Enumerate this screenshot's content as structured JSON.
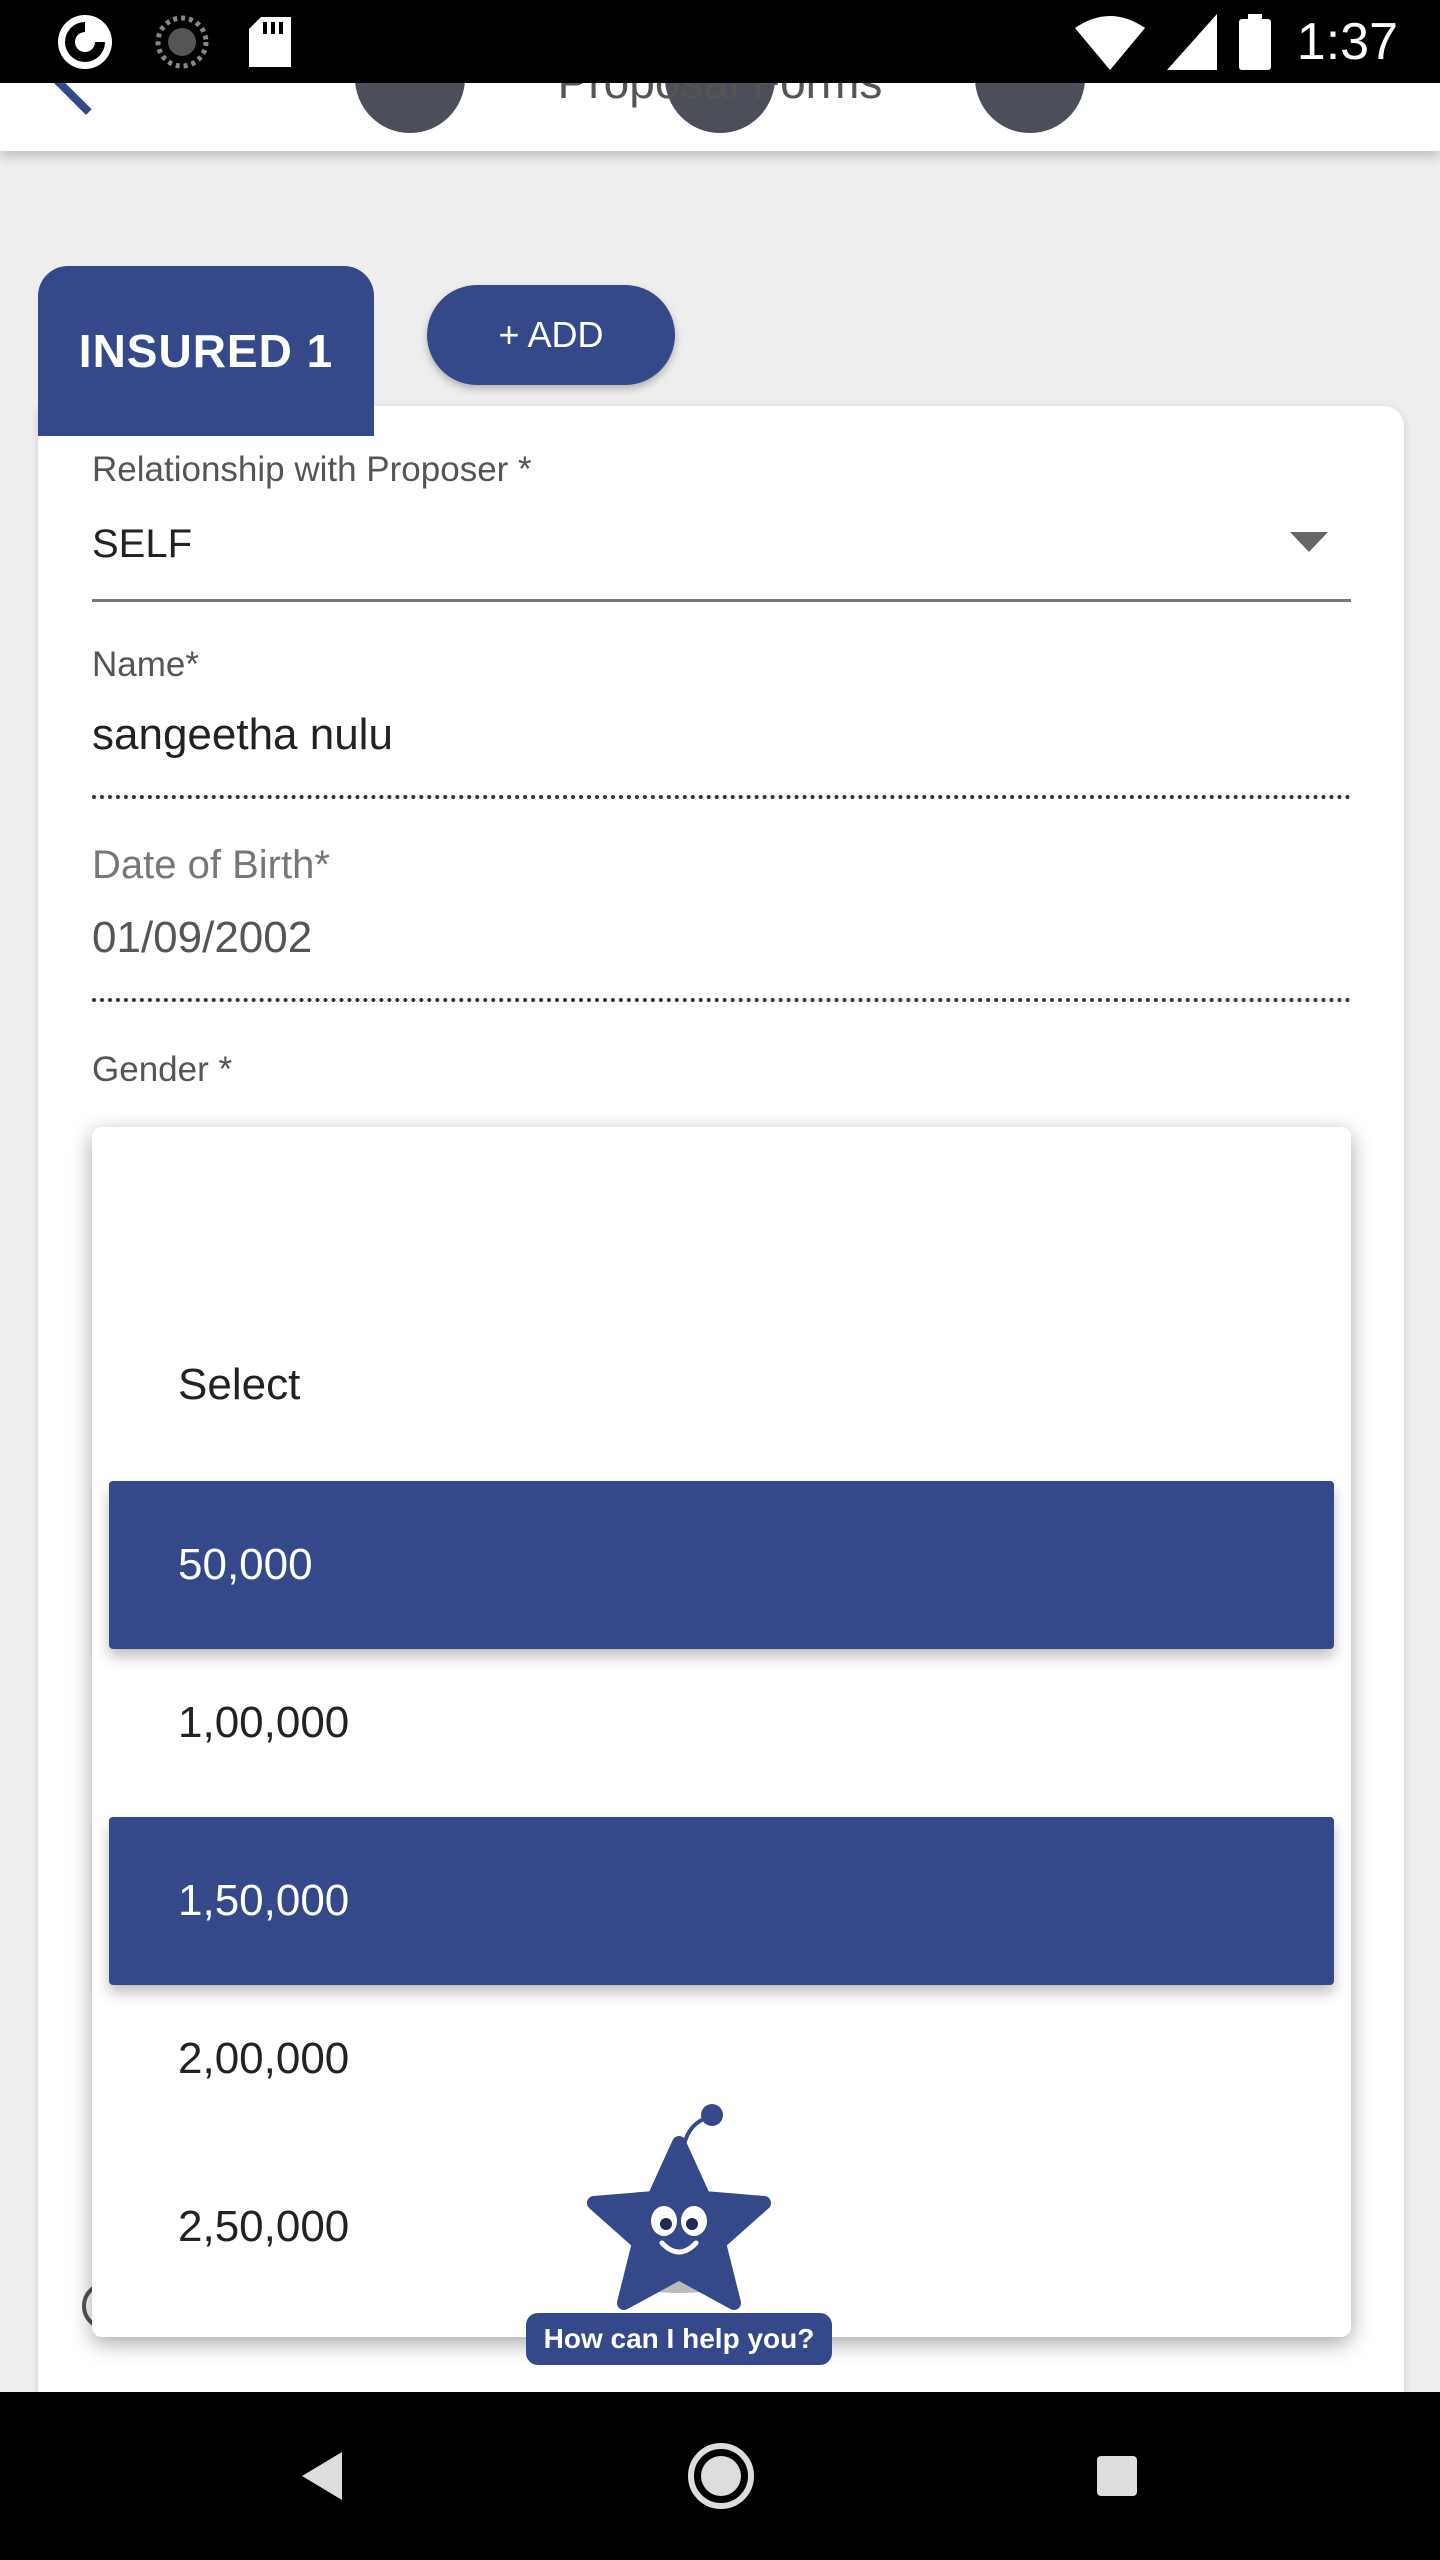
{
  "status_bar": {
    "time": "1:37",
    "icons": [
      "app-notification-icon",
      "loading-icon",
      "sd-card-icon",
      "wifi-icon",
      "signal-icon",
      "battery-icon"
    ]
  },
  "header": {
    "title": "Proposal Forms"
  },
  "tabs": {
    "insured_label": "INSURED 1",
    "add_label": "+ ADD"
  },
  "form": {
    "relationship": {
      "label": "Relationship with Proposer *",
      "value": "SELF"
    },
    "name": {
      "label": "Name*",
      "value": "sangeetha nulu"
    },
    "dob": {
      "label": "Date of Birth*",
      "value": "01/09/2002"
    },
    "gender": {
      "label": "Gender *"
    }
  },
  "dropdown": {
    "options": [
      {
        "label": "Select",
        "highlighted": false
      },
      {
        "label": "50,000",
        "highlighted": true
      },
      {
        "label": "1,00,000",
        "highlighted": false
      },
      {
        "label": "1,50,000",
        "highlighted": true
      },
      {
        "label": "2,00,000",
        "highlighted": false
      },
      {
        "label": "2,50,000",
        "highlighted": false
      }
    ]
  },
  "chatbot": {
    "prompt": "How can I help you?"
  },
  "colors": {
    "brand": "#354889",
    "status_bar": "#000000",
    "background": "#eeeeee"
  }
}
